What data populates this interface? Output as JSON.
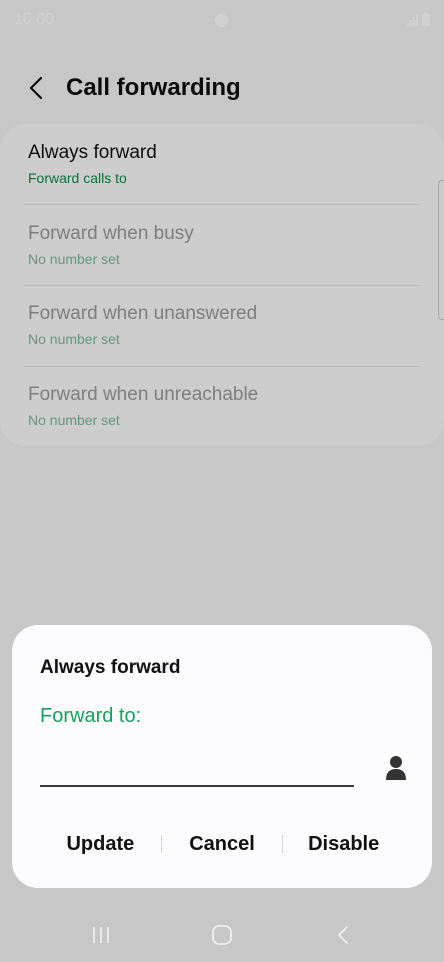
{
  "status_bar": {
    "time": "10:00"
  },
  "header": {
    "title": "Call forwarding"
  },
  "settings": {
    "items": [
      {
        "title": "Always forward",
        "subtitle": "Forward calls to",
        "enabled": true
      },
      {
        "title": "Forward when busy",
        "subtitle": "No number set",
        "enabled": false
      },
      {
        "title": "Forward when unanswered",
        "subtitle": "No number set",
        "enabled": false
      },
      {
        "title": "Forward when unreachable",
        "subtitle": "No number set",
        "enabled": false
      }
    ]
  },
  "dialog": {
    "title": "Always forward",
    "field_label": "Forward to:",
    "input_value": "",
    "buttons": {
      "update": "Update",
      "cancel": "Cancel",
      "disable": "Disable"
    }
  },
  "icons": {
    "back": "chevron-left-icon",
    "contact": "person-icon",
    "nav_recents": "recents-icon",
    "nav_home": "home-icon",
    "nav_back": "back-icon"
  },
  "colors": {
    "accent": "#16a05a",
    "subtitle_enabled": "#0b8a45",
    "subtitle_disabled": "#7fb898"
  }
}
